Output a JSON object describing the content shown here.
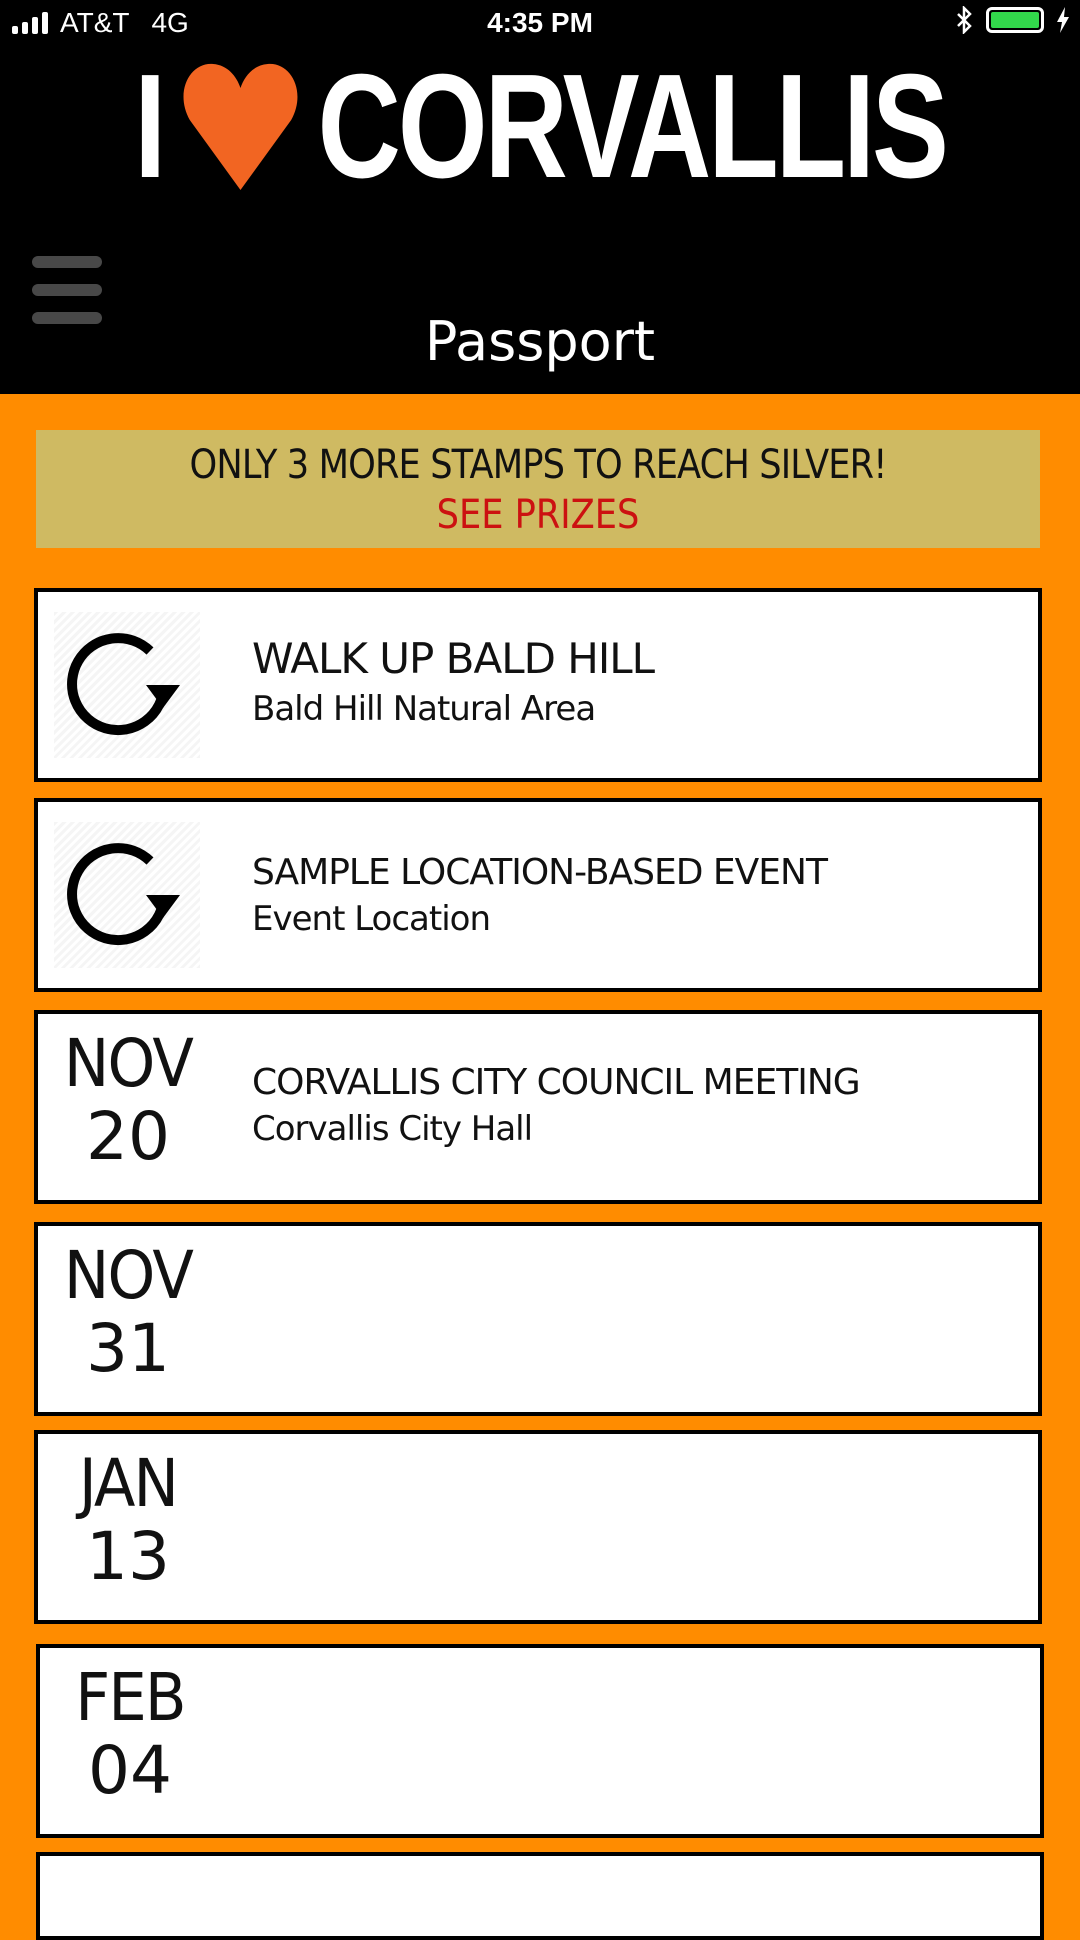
{
  "status_bar": {
    "carrier": "AT&T",
    "network": "4G",
    "time": "4:35 PM"
  },
  "header": {
    "logo_left": "I",
    "logo_right": "CORVALLIS",
    "page_title": "Passport"
  },
  "colors": {
    "accent": "#ff8c00",
    "heart": "#f26522",
    "banner_bg": "#cfba62",
    "prize_link": "#cc1111"
  },
  "banner": {
    "message": "ONLY 3 MORE STAMPS TO REACH SILVER!",
    "link": "SEE PRIZES"
  },
  "events": [
    {
      "icon": "refresh-icon",
      "title": "WALK UP BALD HILL",
      "location": "Bald Hill Natural Area"
    },
    {
      "icon": "refresh-icon",
      "title": "SAMPLE LOCATION-BASED EVENT",
      "location": "Event Location"
    },
    {
      "month": "NOV",
      "day": "20",
      "title": "CORVALLIS CITY COUNCIL MEETING",
      "location": "Corvallis City Hall"
    },
    {
      "month": "NOV",
      "day": "31"
    },
    {
      "month": "JAN",
      "day": "13"
    },
    {
      "month": "FEB",
      "day": "04"
    }
  ]
}
